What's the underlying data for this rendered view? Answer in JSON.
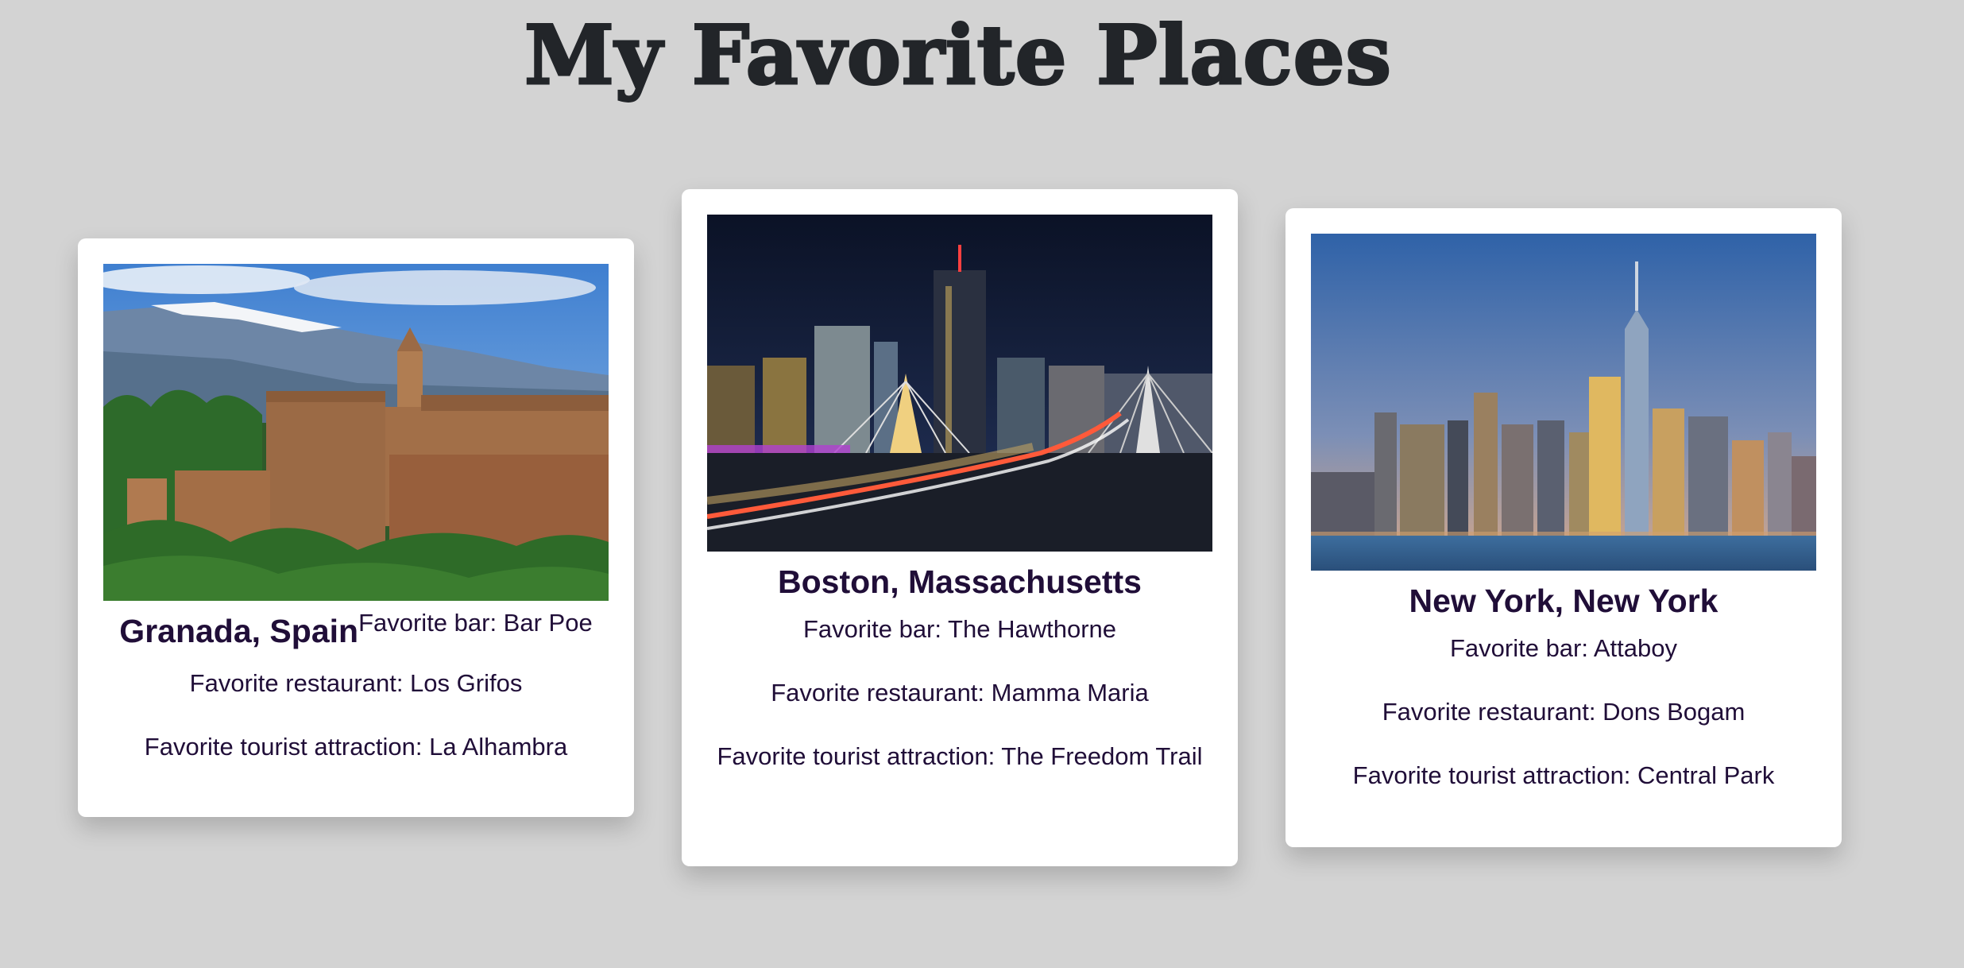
{
  "page": {
    "title": "My Favorite Places"
  },
  "cards": [
    {
      "city": "Granada, Spain",
      "bar": "Favorite bar: Bar Poe",
      "restaurant": "Favorite restaurant: Los Grifos",
      "attraction": "Favorite tourist attraction: La Alhambra",
      "image": "granada-alhambra-photo"
    },
    {
      "city": "Boston, Massachusetts",
      "bar": "Favorite bar: The Hawthorne",
      "restaurant": "Favorite restaurant: Mamma Maria",
      "attraction": "Favorite tourist attraction: The Freedom Trail",
      "image": "boston-skyline-night-photo"
    },
    {
      "city": "New York, New York",
      "bar": "Favorite bar: Attaboy",
      "restaurant": "Favorite restaurant: Dons Bogam",
      "attraction": "Favorite tourist attraction: Central Park",
      "image": "new-york-skyline-photo"
    }
  ],
  "colors": {
    "background": "#d3d3d3",
    "card": "#ffffff",
    "text": "#200e38",
    "title": "#222529"
  }
}
